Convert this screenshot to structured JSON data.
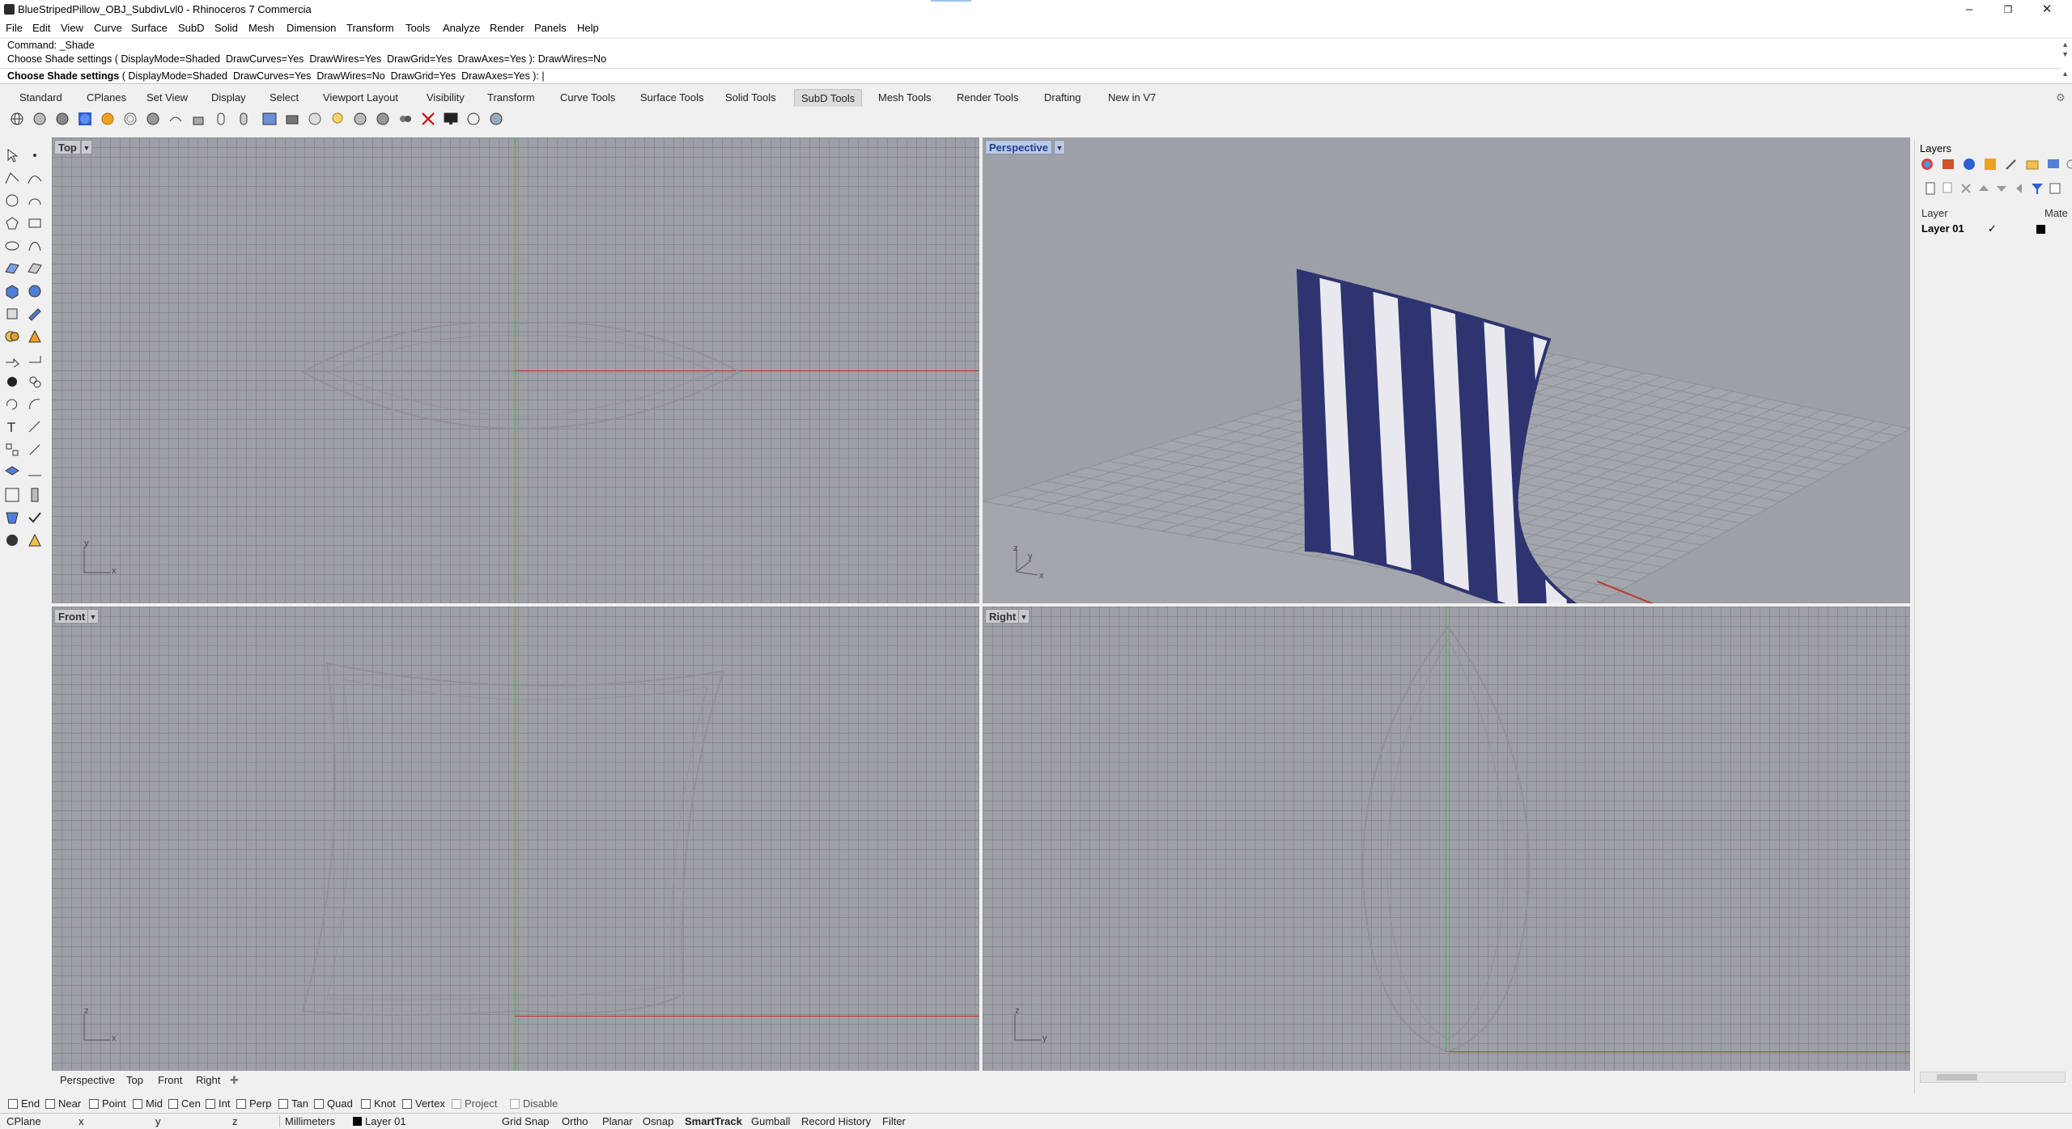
{
  "window": {
    "title": "BlueStripedPillow_OBJ_SubdivLvl0 - Rhinoceros 7 Commercia",
    "controls": [
      "minimize-icon",
      "restore-icon",
      "close-icon"
    ]
  },
  "menu": [
    "File",
    "Edit",
    "View",
    "Curve",
    "Surface",
    "SubD",
    "Solid",
    "Mesh",
    "Dimension",
    "Transform",
    "Tools",
    "Analyze",
    "Render",
    "Panels",
    "Help"
  ],
  "command": {
    "line1": "Command: _Shade",
    "line2": "Choose Shade settings ( DisplayMode=Shaded  DrawCurves=Yes  DrawWires=Yes  DrawGrid=Yes  DrawAxes=Yes ): DrawWires=No",
    "prompt_bold": "Choose Shade settings",
    "prompt_rest": " ( DisplayMode=Shaded  DrawCurves=Yes  DrawWires=No  DrawGrid=Yes  DrawAxes=Yes ): |"
  },
  "tabs": [
    "Standard",
    "CPlanes",
    "Set View",
    "Display",
    "Select",
    "Viewport Layout",
    "Visibility",
    "Transform",
    "Curve Tools",
    "Surface Tools",
    "Solid Tools",
    "SubD Tools",
    "Mesh Tools",
    "Render Tools",
    "Drafting",
    "New in V7"
  ],
  "active_tab": "SubD Tools",
  "viewports": {
    "top": {
      "title": "Top",
      "axis_a": "y",
      "axis_b": "x"
    },
    "perspective": {
      "title": "Perspective",
      "axis_a": "z",
      "axis_b": "y",
      "axis_c": "x"
    },
    "front": {
      "title": "Front",
      "axis_a": "z",
      "axis_b": "x"
    },
    "right": {
      "title": "Right",
      "axis_a": "z",
      "axis_b": "y"
    }
  },
  "viewport_tabs": [
    "Perspective",
    "Top",
    "Front",
    "Right"
  ],
  "osnaps": [
    "End",
    "Near",
    "Point",
    "Mid",
    "Cen",
    "Int",
    "Perp",
    "Tan",
    "Quad",
    "Knot",
    "Vertex",
    "Project",
    "Disable"
  ],
  "status": {
    "cplane": "CPlane",
    "x": "x",
    "y": "y",
    "z": "z",
    "units": "Millimeters",
    "layer": "Layer 01",
    "toggles": [
      "Grid Snap",
      "Ortho",
      "Planar",
      "Osnap",
      "SmartTrack",
      "Gumball",
      "Record History",
      "Filter"
    ],
    "bold_toggle": "SmartTrack"
  },
  "layers_panel": {
    "title": "Layers",
    "col_layer": "Layer",
    "col_material": "Mate",
    "rows": [
      {
        "name": "Layer 01",
        "current": "✓",
        "color": "#000000"
      }
    ]
  },
  "colors": {
    "pillow_navy": "#2e3470",
    "pillow_white": "#e8e8ee",
    "viewport_bg": "#9da0a6",
    "active_view": "#b8c9ea"
  }
}
